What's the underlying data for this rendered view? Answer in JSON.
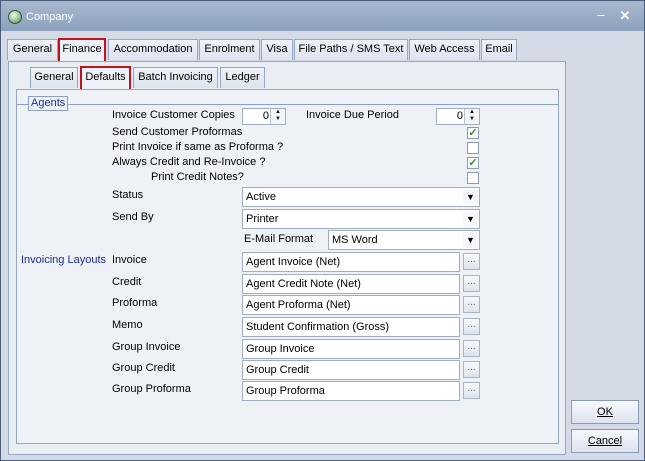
{
  "window": {
    "title": "Company",
    "minimize_glyph": "–",
    "close_glyph": "✕"
  },
  "main_tabs": [
    "General",
    "Finance",
    "Accommodation",
    "Enrolment",
    "Visa",
    "File Paths / SMS Text",
    "Web Access",
    "Email"
  ],
  "sub_tabs": [
    "General",
    "Defaults",
    "Batch Invoicing",
    "Ledger"
  ],
  "group": {
    "label": "Agents"
  },
  "fields": {
    "invoice_customer_copies": {
      "label": "Invoice Customer Copies",
      "value": "0"
    },
    "invoice_due_period": {
      "label": "Invoice Due Period",
      "value": "0"
    },
    "send_customer_proformas": {
      "label": "Send Customer Proformas",
      "checked": true
    },
    "print_invoice_if_same": {
      "label": "Print Invoice if same as Proforma ?",
      "checked": false
    },
    "always_credit_reinvoice": {
      "label": "Always Credit and Re-Invoice ?",
      "checked": true
    },
    "print_credit_notes": {
      "label": "Print Credit Notes?",
      "checked": false
    },
    "status": {
      "label": "Status",
      "value": "Active"
    },
    "send_by": {
      "label": "Send By",
      "value": "Printer"
    },
    "email_format": {
      "label": "E-Mail Format",
      "value": "MS Word"
    }
  },
  "check_glyph": "✓",
  "dropdown_glyph": "▼",
  "spin_up_glyph": "▲",
  "spin_down_glyph": "▼",
  "ellipsis_glyph": "...",
  "layouts": {
    "section_label": "Invoicing Layouts",
    "rows": [
      {
        "label": "Invoice",
        "value": "Agent Invoice (Net)"
      },
      {
        "label": "Credit",
        "value": "Agent Credit Note (Net)"
      },
      {
        "label": "Proforma",
        "value": "Agent Proforma (Net)"
      },
      {
        "label": "Memo",
        "value": "Student Confirmation (Gross)"
      },
      {
        "label": "Group Invoice",
        "value": "Group Invoice"
      },
      {
        "label": "Group Credit",
        "value": "Group Credit"
      },
      {
        "label": "Group Proforma",
        "value": "Group Proforma"
      }
    ]
  },
  "buttons": {
    "ok": "OK",
    "cancel": "Cancel"
  }
}
